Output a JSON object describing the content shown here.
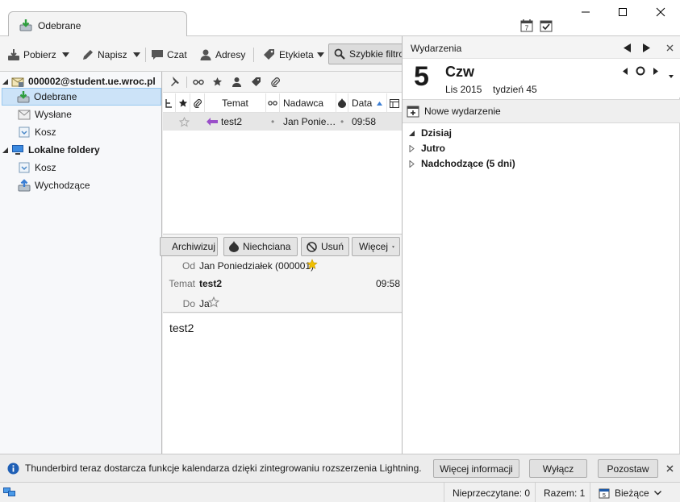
{
  "tab": {
    "label": "Odebrane"
  },
  "window": {
    "calendar_icon_day": "7"
  },
  "toolbar": {
    "get_mail": "Pobierz",
    "write": "Napisz",
    "chat": "Czat",
    "address_book": "Adresy",
    "tag": "Etykieta",
    "quick_filter": "Szybkie filtro"
  },
  "folders": {
    "account": "000002@student.ue.wroc.pl",
    "inbox": "Odebrane",
    "sent": "Wysłane",
    "trash": "Kosz",
    "local_folders": "Lokalne foldery",
    "local_trash": "Kosz",
    "outbox": "Wychodzące"
  },
  "thread": {
    "columns": {
      "subject": "Temat",
      "sender": "Nadawca",
      "date": "Data"
    },
    "rows": [
      {
        "subject": "test2",
        "sender": "Jan Ponie…",
        "date": "09:58"
      }
    ]
  },
  "header": {
    "archive": "Archiwizuj",
    "junk": "Niechciana",
    "delete": "Usuń",
    "more": "Więcej",
    "from_label": "Od",
    "from_value": "Jan Poniedziałek (000001)",
    "subject_label": "Temat",
    "subject_value": "test2",
    "time": "09:58",
    "to_label": "Do",
    "to_value": "Ja"
  },
  "body": {
    "text": "test2"
  },
  "today_pane": {
    "title": "Wydarzenia",
    "day_number": "5",
    "weekday": "Czw",
    "month_year": "Lis 2015",
    "week": "tydzień 45",
    "new_event": "Nowe wydarzenie",
    "agenda": {
      "today": "Dzisiaj",
      "tomorrow": "Jutro",
      "upcoming": "Nadchodzące (5 dni)"
    }
  },
  "notification": {
    "text": "Thunderbird teraz dostarcza funkcje kalendarza dzięki zintegrowaniu rozszerzenia Lightning.",
    "more_info": "Więcej informacji",
    "disable": "Wyłącz",
    "keep": "Pozostaw"
  },
  "status": {
    "unread": "Nieprzeczytane: 0",
    "total": "Razem: 1",
    "today_button": "Bieżące",
    "today_icon_day": "5"
  },
  "colors": {
    "selection": "#cce3f8",
    "accent": "#3c7fd4",
    "inbox_green": "#2e9e3e",
    "star_gold": "#f0c000"
  }
}
